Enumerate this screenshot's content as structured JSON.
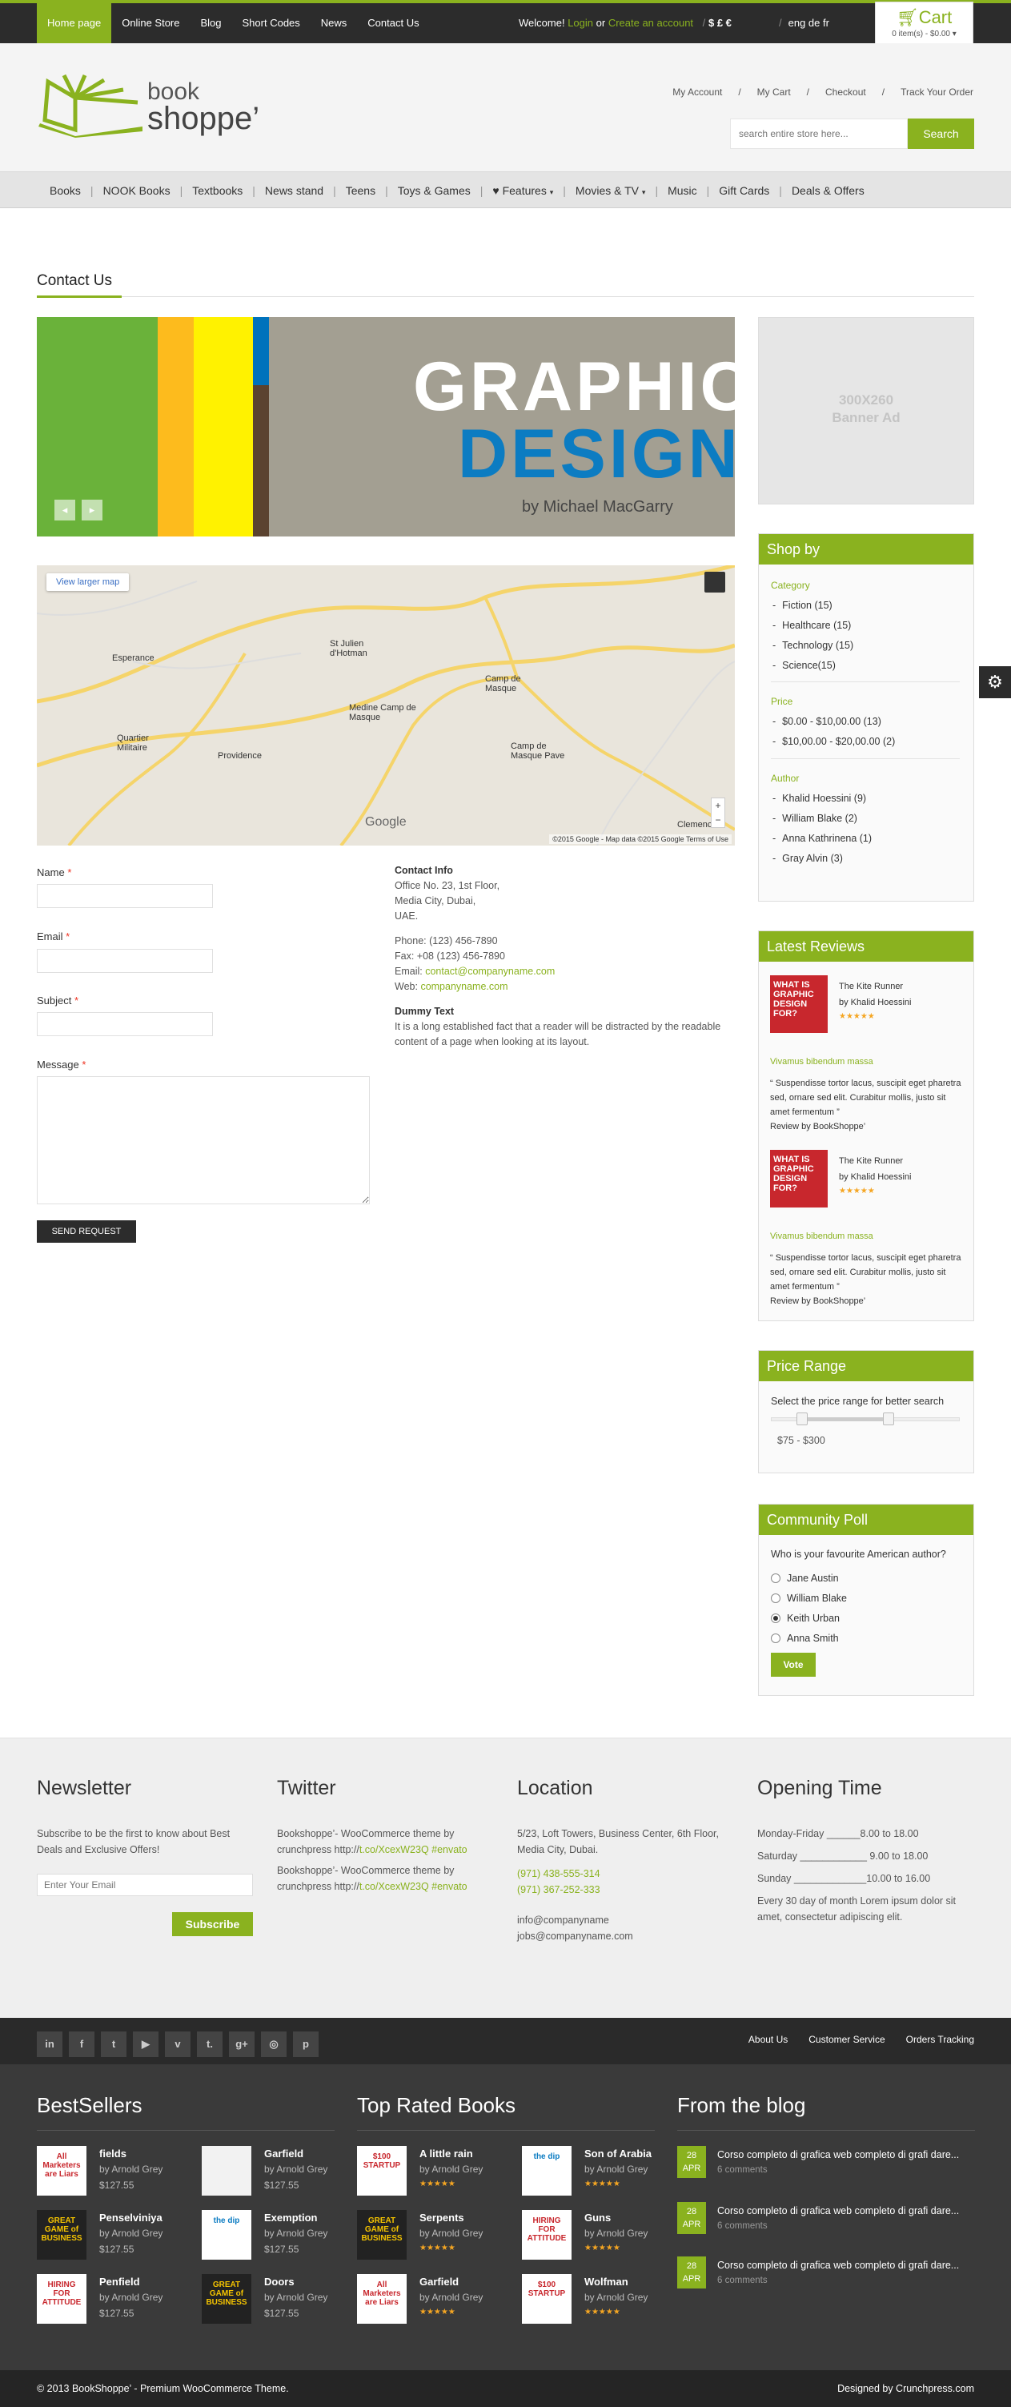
{
  "topbar": {
    "nav": [
      "Home page",
      "Online Store",
      "Blog",
      "Short Codes",
      "News",
      "Contact Us"
    ],
    "welcome": "Welcome!",
    "login": "Login",
    "or": "or",
    "create": "Create an account",
    "currencies": "$  £  €",
    "languages": "eng  de  fr"
  },
  "cart": {
    "title": "Cart",
    "summary": "0 item(s) - $0.00"
  },
  "header": {
    "logo_top": "book",
    "logo_bottom": "shoppe’",
    "links": [
      "My Account",
      "My Cart",
      "Checkout",
      "Track Your Order"
    ],
    "search_placeholder": "search entire store here...",
    "search_button": "Search"
  },
  "categories": [
    "Books",
    "NOOK Books",
    "Textbooks",
    "News stand",
    "Teens",
    "Toys & Games",
    "Features",
    "Movies & TV",
    "Music",
    "Gift Cards",
    "Deals & Offers"
  ],
  "page": {
    "title": "Contact Us"
  },
  "banner": {
    "line1": "GRAPHIC",
    "line2": "DESIGN",
    "author": "by Michael MacGarry",
    "prev": "◂",
    "next": "▸"
  },
  "map": {
    "view_larger": "View larger map",
    "labels": [
      "Esperance",
      "St Julien d'Hotman",
      "Camp de Masque",
      "Medine Camp de Masque",
      "Quartier Militaire",
      "Providence",
      "Camp de Masque Pave",
      "Clemencia"
    ],
    "google": "Google",
    "footer": "©2015 Google - Map data ©2015 Google   Terms of Use"
  },
  "form": {
    "name": "Name",
    "email": "Email",
    "subject": "Subject",
    "message": "Message",
    "required": "*",
    "send": "SEND REQUEST"
  },
  "contact": {
    "heading": "Contact Info",
    "address": [
      "Office No. 23, 1st Floor,",
      "Media City, Dubai,",
      "UAE."
    ],
    "phone": "Phone: (123) 456-7890",
    "fax": "Fax: +08 (123) 456-7890",
    "email_label": "Email:",
    "email": "contact@companyname.com",
    "web_label": "Web:",
    "web": "companyname.com",
    "dummy_heading": "Dummy Text",
    "dummy_text": "It is a long established fact that a reader will be distracted by the readable content of a page when looking at its layout."
  },
  "ad": {
    "size": "300X260",
    "label": "Banner Ad"
  },
  "shopby": {
    "title": "Shop by",
    "category_label": "Category",
    "categories": [
      "Fiction (15)",
      "Healthcare (15)",
      "Technology (15)",
      "Science(15)"
    ],
    "price_label": "Price",
    "prices": [
      "$0.00 - $10,00.00 (13)",
      "$10,00.00 - $20,00.00 (2)"
    ],
    "author_label": "Author",
    "authors": [
      "Khalid Hoessini (9)",
      "William Blake (2)",
      "Anna Kathrinena (1)",
      "Gray Alvin (3)"
    ]
  },
  "reviews": {
    "title": "Latest Reviews",
    "items": [
      {
        "cover": "WHAT IS GRAPHIC DESIGN FOR?",
        "book": "The Kite Runner",
        "author": "by Khalid Hoessini",
        "stars": "★★★★★",
        "heading": "Vivamus bibendum massa",
        "text": "“ Suspendisse tortor lacus, suscipit eget pharetra sed, ornare sed elit. Curabitur mollis, justo sit amet fermentum ”",
        "by": "Review by BookShoppe’"
      },
      {
        "cover": "WHAT IS GRAPHIC DESIGN FOR?",
        "book": "The Kite Runner",
        "author": "by Khalid Hoessini",
        "stars": "★★★★★",
        "heading": "Vivamus bibendum massa",
        "text": "“ Suspendisse tortor lacus, suscipit eget pharetra sed, ornare sed elit. Curabitur mollis, justo sit amet fermentum ”",
        "by": "Review by BookShoppe’"
      }
    ]
  },
  "price_range": {
    "title": "Price Range",
    "hint": "Select the price range for better search",
    "value": "$75 - $300",
    "low_fraction": 0.16,
    "high_fraction": 0.62
  },
  "poll": {
    "title": "Community Poll",
    "question": "Who is your favourite American author?",
    "options": [
      "Jane Austin",
      "William Blake",
      "Keith Urban",
      "Anna Smith"
    ],
    "selected": 2,
    "vote": "Vote"
  },
  "footer": {
    "newsletter": {
      "title": "Newsletter",
      "text": "Subscribe to be the first to know about Best Deals and Exclusive Offers!",
      "placeholder": "Enter Your Email",
      "button": "Subscribe"
    },
    "twitter": {
      "title": "Twitter",
      "tweets": [
        {
          "text": "Bookshoppe’- WooCommerce theme by crunchpress http://",
          "link": "t.co/XcexW23Q #envato"
        },
        {
          "text": "Bookshoppe’- WooCommerce theme by crunchpress http://",
          "link": "t.co/XcexW23Q #envato"
        }
      ]
    },
    "location": {
      "title": "Location",
      "address": "5/23, Loft Towers, Business Center, 6th Floor, Media City, Dubai.",
      "phone1": "(971) 438-555-314",
      "phone2": "(971) 367-252-333",
      "email1": "info@companyname",
      "email2": "jobs@companyname.com"
    },
    "opening": {
      "title": "Opening Time",
      "rows": [
        "Monday-Friday ______8.00 to 18.00",
        "Saturday ____________ 9.00 to 18.00",
        "Sunday _____________10.00 to 16.00"
      ],
      "note": "Every 30 day of month Lorem ipsum dolor sit amet, consectetur adipiscing elit."
    }
  },
  "social": {
    "icons": [
      "in",
      "f",
      "t",
      "▶",
      "v",
      "t.",
      "g+",
      "◎",
      "p"
    ],
    "links": [
      "About Us",
      "Customer Service",
      "Orders Tracking"
    ]
  },
  "bestsellers": {
    "title": "BestSellers",
    "items": [
      {
        "cover": "All Marketers are Liars",
        "name": "fields",
        "author": "by Arnold Grey",
        "price": "$127.55"
      },
      {
        "cover": "",
        "name": "Garfield",
        "author": "by Arnold Grey",
        "price": "$127.55"
      },
      {
        "cover": "GREAT GAME of BUSINESS",
        "name": "Penselviniya",
        "author": "by Arnold Grey",
        "price": "$127.55"
      },
      {
        "cover": "the dip",
        "name": "Exemption",
        "author": "by Arnold Grey",
        "price": "$127.55"
      },
      {
        "cover": "HIRING FOR ATTITUDE",
        "name": "Penfield",
        "author": "by Arnold Grey",
        "price": "$127.55"
      },
      {
        "cover": "GREAT GAME of BUSINESS",
        "name": "Doors",
        "author": "by Arnold Grey",
        "price": "$127.55"
      }
    ]
  },
  "toprated": {
    "title": "Top Rated Books",
    "items": [
      {
        "cover": "$100 STARTUP",
        "name": "A little rain",
        "author": "by Arnold Grey",
        "stars": "★★★★★"
      },
      {
        "cover": "the dip",
        "name": "Son of Arabia",
        "author": "by Arnold Grey",
        "stars": "★★★★★"
      },
      {
        "cover": "GREAT GAME of BUSINESS",
        "name": "Serpents",
        "author": "by Arnold Grey",
        "stars": "★★★★★"
      },
      {
        "cover": "HIRING FOR ATTITUDE",
        "name": "Guns",
        "author": "by Arnold Grey",
        "stars": "★★★★★"
      },
      {
        "cover": "All Marketers are Liars",
        "name": "Garfield",
        "author": "by Arnold Grey",
        "stars": "★★★★★"
      },
      {
        "cover": "$100 STARTUP",
        "name": "Wolfman",
        "author": "by Arnold Grey",
        "stars": "★★★★★"
      }
    ]
  },
  "blog": {
    "title": "From the blog",
    "items": [
      {
        "day": "28",
        "month": "APR",
        "title": "Corso completo di grafica web completo di grafi dare...",
        "comments": "6 comments"
      },
      {
        "day": "28",
        "month": "APR",
        "title": "Corso completo di grafica web completo di grafi dare...",
        "comments": "6 comments"
      },
      {
        "day": "28",
        "month": "APR",
        "title": "Corso completo di grafica web completo di grafi dare...",
        "comments": "6 comments"
      }
    ]
  },
  "copyright": {
    "left": "© 2013 BookShoppe’ - Premium WooCommerce Theme.",
    "right": "Designed by Crunchpress.com"
  },
  "colors": {
    "accent": "#8ab21f",
    "dark": "#2c2c2c",
    "footer": "#3a3a3a"
  }
}
